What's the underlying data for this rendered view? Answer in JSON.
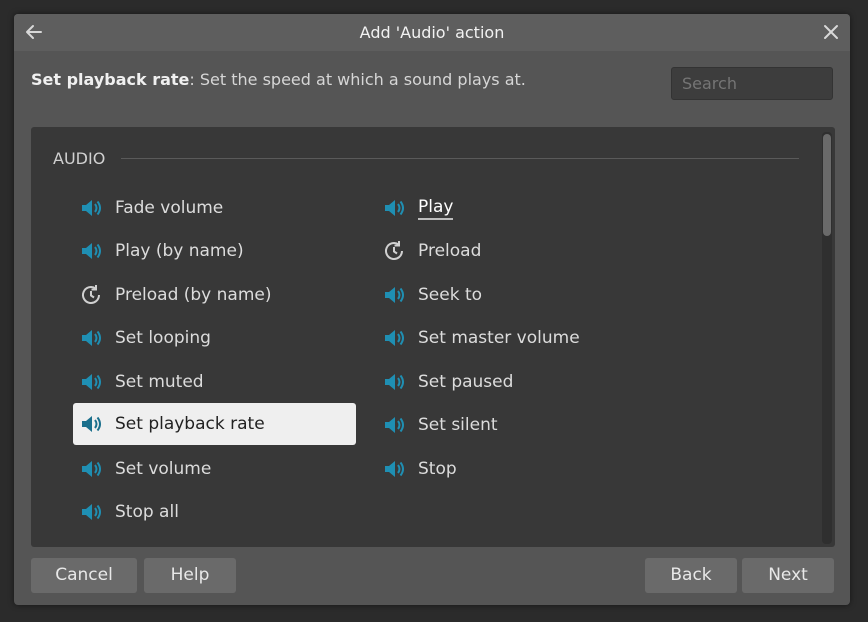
{
  "dialog": {
    "title": "Add 'Audio' action",
    "back_icon": "arrow-left-icon",
    "close_icon": "close-icon"
  },
  "description": {
    "action_name": "Set playback rate",
    "text": ": Set the speed at which a sound plays at."
  },
  "search": {
    "placeholder": "Search"
  },
  "section": {
    "title": "AUDIO"
  },
  "actions": {
    "left": [
      {
        "label": "Fade volume",
        "icon": "speaker-icon"
      },
      {
        "label": "Play (by name)",
        "icon": "speaker-icon"
      },
      {
        "label": "Preload (by name)",
        "icon": "preload-clock-icon"
      },
      {
        "label": "Set looping",
        "icon": "speaker-icon"
      },
      {
        "label": "Set muted",
        "icon": "speaker-icon"
      },
      {
        "label": "Set playback rate",
        "icon": "speaker-icon"
      },
      {
        "label": "Set volume",
        "icon": "speaker-icon"
      },
      {
        "label": "Stop all",
        "icon": "speaker-icon"
      }
    ],
    "right": [
      {
        "label": "Play",
        "icon": "speaker-icon"
      },
      {
        "label": "Preload",
        "icon": "preload-clock-icon"
      },
      {
        "label": "Seek to",
        "icon": "speaker-icon"
      },
      {
        "label": "Set master volume",
        "icon": "speaker-icon"
      },
      {
        "label": "Set paused",
        "icon": "speaker-icon"
      },
      {
        "label": "Set silent",
        "icon": "speaker-icon"
      },
      {
        "label": "Stop",
        "icon": "speaker-icon"
      }
    ],
    "selected": "Set playback rate",
    "hovered": "Play"
  },
  "footer": {
    "cancel": "Cancel",
    "help": "Help",
    "back": "Back",
    "next": "Next"
  },
  "colors": {
    "accent_icon": "#1f8fb3",
    "selected_bg": "#efefef"
  }
}
